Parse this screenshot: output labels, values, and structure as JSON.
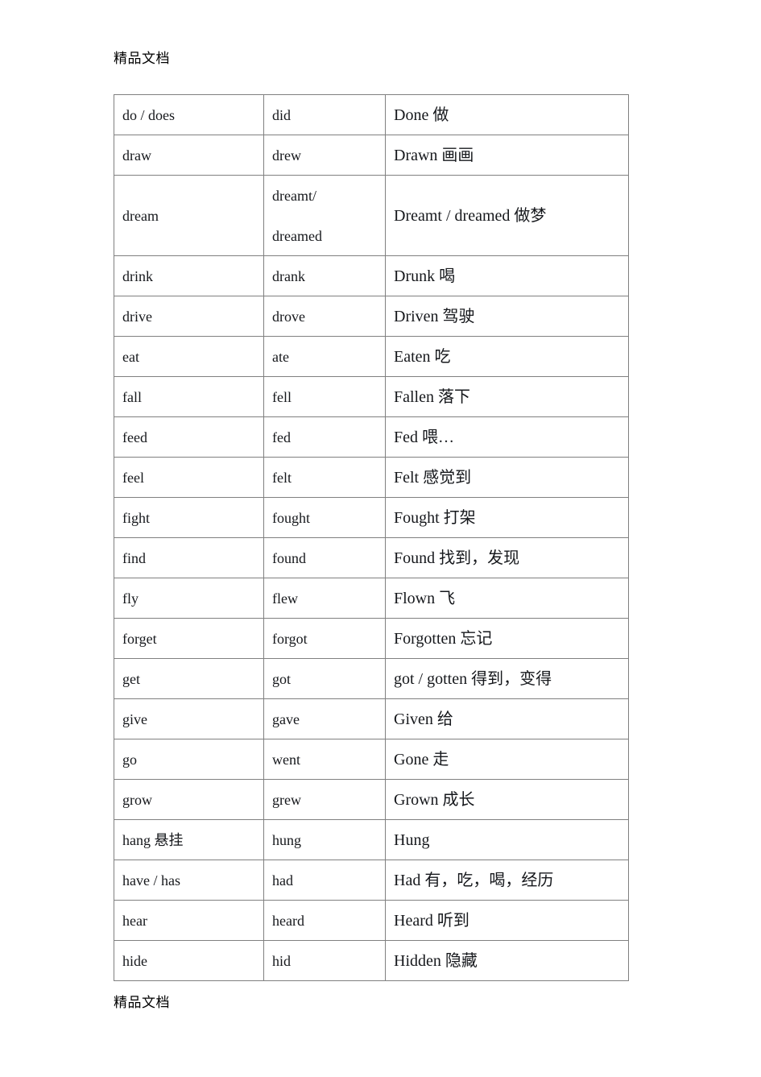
{
  "document": {
    "header_watermark": "精品文档",
    "footer_watermark": "精品文档"
  },
  "table": {
    "columns": [
      "base_form",
      "past_simple",
      "past_participle"
    ],
    "rows": [
      {
        "base": "do  /  does",
        "past": "did",
        "past2": "",
        "participle": "Done 做"
      },
      {
        "base": "draw",
        "past": "drew",
        "past2": "",
        "participle": "Drawn 画画"
      },
      {
        "base": "dream",
        "past": "dreamt/",
        "past2": "dreamed",
        "participle": "Dreamt / dreamed 做梦"
      },
      {
        "base": "drink",
        "past": "drank",
        "past2": "",
        "participle": "Drunk 喝"
      },
      {
        "base": "drive",
        "past": "drove",
        "past2": "",
        "participle": "Driven 驾驶"
      },
      {
        "base": "eat",
        "past": "ate",
        "past2": "",
        "participle": "Eaten 吃"
      },
      {
        "base": "fall",
        "past": "fell",
        "past2": "",
        "participle": "Fallen 落下"
      },
      {
        "base": "feed",
        "past": "fed",
        "past2": "",
        "participle": "Fed 喂…"
      },
      {
        "base": "feel",
        "past": "felt",
        "past2": "",
        "participle": "Felt 感觉到"
      },
      {
        "base": "fight",
        "past": "fought",
        "past2": "",
        "participle": "Fought 打架"
      },
      {
        "base": "find",
        "past": "found",
        "past2": "",
        "participle": "Found 找到，发现"
      },
      {
        "base": "fly",
        "past": "flew",
        "past2": "",
        "participle": "Flown 飞"
      },
      {
        "base": "forget",
        "past": "forgot",
        "past2": "",
        "participle": "Forgotten 忘记"
      },
      {
        "base": "get",
        "past": "got",
        "past2": "",
        "participle": "got / gotten 得到，变得"
      },
      {
        "base": "give",
        "past": "gave",
        "past2": "",
        "participle": "Given 给"
      },
      {
        "base": "go",
        "past": "went",
        "past2": "",
        "participle": "Gone 走"
      },
      {
        "base": "grow",
        "past": "grew",
        "past2": "",
        "participle": "Grown 成长"
      },
      {
        "base": "hang   悬挂",
        "past": "hung",
        "past2": "",
        "participle": "Hung"
      },
      {
        "base": "have / has",
        "past": "had",
        "past2": "",
        "participle": "Had 有，吃，喝，经历"
      },
      {
        "base": "hear",
        "past": "heard",
        "past2": "",
        "participle": "Heard 听到"
      },
      {
        "base": "hide",
        "past": "hid",
        "past2": "",
        "participle": "Hidden 隐藏"
      }
    ]
  },
  "colors": {
    "border": "#808080",
    "text": "#16181c",
    "background": "#ffffff"
  }
}
